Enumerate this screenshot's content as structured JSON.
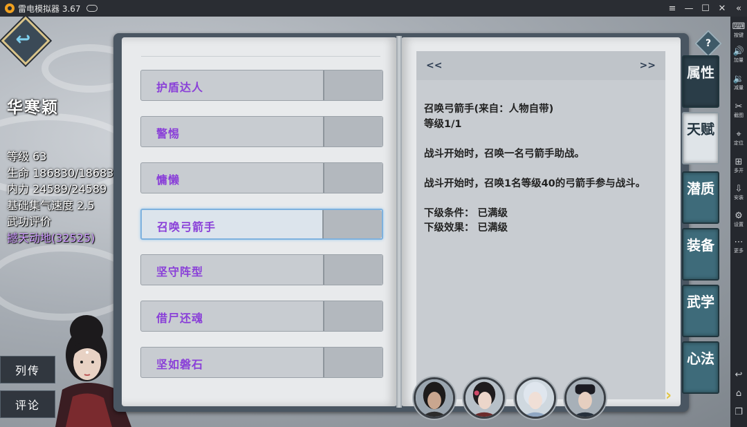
{
  "emulator": {
    "title": "雷电模拟器 3.67",
    "controls": [
      "≡",
      "—",
      "☐",
      "✕",
      "«"
    ],
    "toolbar": [
      {
        "icon": "keyboard-icon",
        "glyph": "⌨",
        "label": "按键"
      },
      {
        "icon": "volume-up-icon",
        "glyph": "🔊",
        "label": "加量"
      },
      {
        "icon": "volume-down-icon",
        "glyph": "🔉",
        "label": "减量"
      },
      {
        "icon": "scissors-icon",
        "glyph": "✂",
        "label": "截图"
      },
      {
        "icon": "location-pin-icon",
        "glyph": "⌖",
        "label": "定位"
      },
      {
        "icon": "multi-instance-icon",
        "glyph": "⊞",
        "label": "多开"
      },
      {
        "icon": "apk-install-icon",
        "glyph": "⇩",
        "label": "安装"
      },
      {
        "icon": "gear-icon",
        "glyph": "⚙",
        "label": "设置"
      },
      {
        "icon": "more-dots-icon",
        "glyph": "⋯",
        "label": "更多"
      }
    ],
    "bottom_nav": [
      {
        "icon": "android-back-icon",
        "glyph": "↩"
      },
      {
        "icon": "android-home-icon",
        "glyph": "⌂"
      },
      {
        "icon": "android-recents-icon",
        "glyph": "❐"
      }
    ]
  },
  "character": {
    "name": "华寒颖",
    "level": "等级 63",
    "hp": "生命 186830/186830",
    "mp": "内力 24589/24589",
    "charge": "基础集气速度 2.5",
    "rating_label": "武功评价",
    "rating_value": "撼天动地(32525)"
  },
  "side_buttons": {
    "biography": "列传",
    "comment": "评论"
  },
  "talents": [
    "护盾达人",
    "警惕",
    "慵懒",
    "召唤弓箭手",
    "坚守阵型",
    "借尸还魂",
    "坚如磐石"
  ],
  "selected_talent_index": 3,
  "detail": {
    "nav_prev": "<<",
    "nav_next": ">>",
    "title": "召唤弓箭手(来自：人物自带)",
    "level": "等级1/1",
    "desc": "战斗开始时，召唤一名弓箭手助战。",
    "desc_detail": "战斗开始时，召唤1名等级40的弓箭手参与战斗。",
    "next_condition": "下级条件：  已满级",
    "next_effect": "下级效果：  已满级"
  },
  "tabs": [
    "属性",
    "天赋",
    "潜质",
    "装备",
    "武学",
    "心法"
  ],
  "active_tab_index": 1,
  "help_label": "?",
  "team_next": "›",
  "colors": {
    "talent_text": "#8a40d8",
    "rating": "#cf9cff",
    "tab": "#3e6b7a",
    "accent_gold": "#e2c646"
  }
}
